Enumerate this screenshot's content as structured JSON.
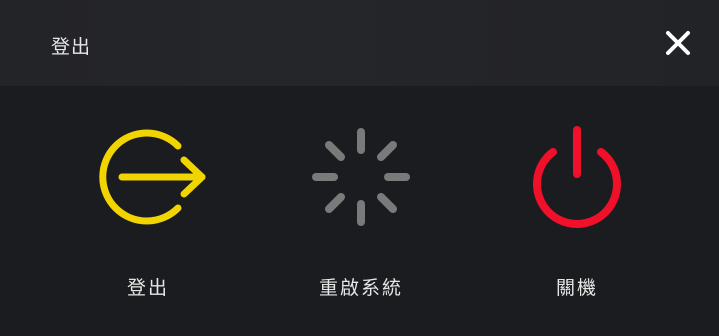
{
  "dialog": {
    "title": "登出",
    "close_icon": "close-icon"
  },
  "options": [
    {
      "label": "登出",
      "icon": "logout-icon",
      "color": "#f2d500"
    },
    {
      "label": "重啟系統",
      "icon": "restart-spinner-icon",
      "color": "#8a8a8a"
    },
    {
      "label": "關機",
      "icon": "power-icon",
      "color": "#f0102a"
    }
  ]
}
